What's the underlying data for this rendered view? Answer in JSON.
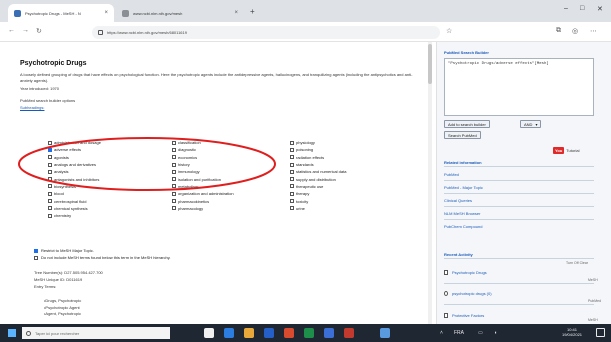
{
  "browser": {
    "tabs": [
      {
        "title": "Psychotropic Drugs - MeSH - N",
        "active": true
      },
      {
        "title": "www.ncbi.nlm.nih.gov/mesh",
        "active": false
      }
    ],
    "url": "https://www.ncbi.nlm.nih.gov/mesh/68011619"
  },
  "page": {
    "title": "Psychotropic Drugs",
    "description": "A loosely defined grouping of drugs that have effects on psychological function. Here the psychotropic agents include the antidepressive agents, hallucinogens, and tranquilizing agents (including the antipsychotics and anti-anxiety agents).",
    "year_introduced": "Year introduced: 1970",
    "pubmed_label": "PubMed search builder options",
    "subheadings_link": "Subheadings:",
    "subheadings": {
      "col1": [
        {
          "label": "administration and dosage",
          "checked": false
        },
        {
          "label": "adverse effects",
          "checked": true
        },
        {
          "label": "agonists",
          "checked": false
        },
        {
          "label": "analogs and derivatives",
          "checked": false
        },
        {
          "label": "analysis",
          "checked": false
        },
        {
          "label": "antagonists and inhibitors",
          "checked": false
        },
        {
          "label": "biosynthesis",
          "checked": false
        },
        {
          "label": "blood",
          "checked": false
        },
        {
          "label": "cerebrospinal fluid",
          "checked": false
        },
        {
          "label": "chemical synthesis",
          "checked": false
        },
        {
          "label": "chemistry",
          "checked": false
        }
      ],
      "col2": [
        {
          "label": "classification",
          "checked": false
        },
        {
          "label": "diagnostic",
          "checked": false
        },
        {
          "label": "economics",
          "checked": false
        },
        {
          "label": "history",
          "checked": false
        },
        {
          "label": "immunology",
          "checked": false
        },
        {
          "label": "isolation and purification",
          "checked": false
        },
        {
          "label": "metabolism",
          "checked": false
        },
        {
          "label": "organization and administration",
          "checked": false
        },
        {
          "label": "pharmacokinetics",
          "checked": false
        },
        {
          "label": "pharmacology",
          "checked": false
        }
      ],
      "col3": [
        {
          "label": "physiology",
          "checked": false
        },
        {
          "label": "poisoning",
          "checked": false
        },
        {
          "label": "radiation effects",
          "checked": false
        },
        {
          "label": "standards",
          "checked": false
        },
        {
          "label": "statistics and numerical data",
          "checked": false
        },
        {
          "label": "supply and distribution",
          "checked": false
        },
        {
          "label": "therapeutic use",
          "checked": false
        },
        {
          "label": "therapy",
          "checked": false
        },
        {
          "label": "toxicity",
          "checked": false
        },
        {
          "label": "urine",
          "checked": false
        }
      ]
    },
    "restrict_major": "Restrict to MeSH Major Topic.",
    "no_explode": "Do not include MeSH terms found below this term in the MeSH hierarchy.",
    "tree_number": "Tree Number(s): D27.505.954.427.700",
    "mesh_unique": "MeSH Unique ID: D011619",
    "entry_terms_label": "Entry Terms:",
    "entry_terms": [
      "Drugs, Psychotropic",
      "Psychotropic Agent",
      "Agent, Psychotropic"
    ]
  },
  "sidebar": {
    "builder_title": "PubMed Search Builder",
    "builder_text": "\"Psychotropic Drugs/adverse effects\"[Mesh]",
    "add_button": "Add to search builder",
    "and_select": "AND",
    "search_button": "Search PubMed",
    "youtube_label": "Tutorial",
    "related_title": "Related information",
    "related_links": [
      "PubMed",
      "PubMed - Major Topic",
      "Clinical Queries",
      "NLM MeSH Browser",
      "PubChem Compound"
    ],
    "recent_title": "Recent Activity",
    "recent_actions": "Turn Off   Clear",
    "recent_items": [
      "Psychotropic Drugs",
      "psychotropic drugs (0)",
      "Protective Factors"
    ],
    "recent_meta": [
      "MeSH",
      "PubMed",
      "MeSH"
    ]
  },
  "taskbar": {
    "search_placeholder": "Taper ici pour rechercher",
    "clock_time": "10:41",
    "clock_date": "19/04/2021",
    "lang": "FRA"
  },
  "colors": {
    "accent": "#1a5ab8",
    "annotation": "#e01e1e",
    "checkbox_checked": "#1e6ee8",
    "taskbar": "#1f2733"
  }
}
